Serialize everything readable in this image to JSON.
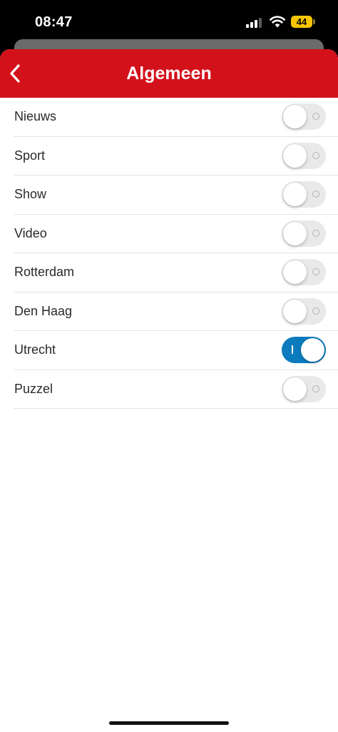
{
  "status_bar": {
    "time": "08:47",
    "battery": "44"
  },
  "nav": {
    "title": "Algemeen",
    "back_icon": "chevron-left-icon"
  },
  "colors": {
    "nav_background": "#d3111a",
    "toggle_on": "#0b7bbd",
    "toggle_off": "#e9e9ea"
  },
  "settings": [
    {
      "label": "Nieuws",
      "enabled": false
    },
    {
      "label": "Sport",
      "enabled": false
    },
    {
      "label": "Show",
      "enabled": false
    },
    {
      "label": "Video",
      "enabled": false
    },
    {
      "label": "Rotterdam",
      "enabled": false
    },
    {
      "label": "Den Haag",
      "enabled": false
    },
    {
      "label": "Utrecht",
      "enabled": true
    },
    {
      "label": "Puzzel",
      "enabled": false
    }
  ]
}
